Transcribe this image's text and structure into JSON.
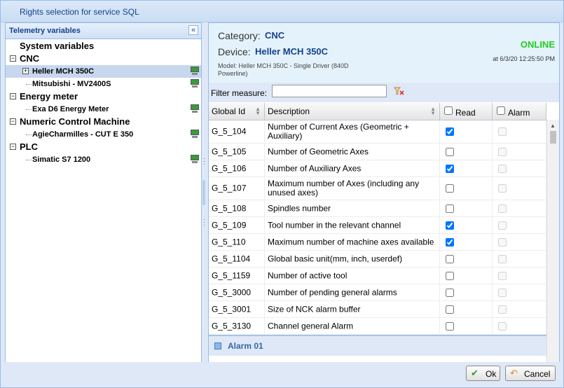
{
  "window": {
    "title": "Rights selection for service SQL"
  },
  "left_panel": {
    "title": "Telemetry variables",
    "tree": [
      {
        "type": "root",
        "label": "System variables"
      },
      {
        "type": "group",
        "label": "CNC",
        "expander": "⊟"
      },
      {
        "type": "leaf",
        "label": "Heller MCH 350C",
        "expander": "⊞",
        "selected": true
      },
      {
        "type": "leaf",
        "label": "Mitsubishi - MV2400S"
      },
      {
        "type": "group",
        "label": "Energy meter",
        "expander": "⊟"
      },
      {
        "type": "leaf",
        "label": "Exa D6 Energy Meter"
      },
      {
        "type": "group",
        "label": "Numeric Control Machine",
        "expander": "⊟"
      },
      {
        "type": "leaf",
        "label": "AgieCharmilles - CUT E 350"
      },
      {
        "type": "group",
        "label": "PLC",
        "expander": "⊟"
      },
      {
        "type": "leaf",
        "label": "Simatic S7 1200"
      }
    ]
  },
  "info": {
    "category_label": "Category:",
    "category_value": "CNC",
    "device_label": "Device:",
    "device_value": "Heller MCH 350C",
    "model": "Model: Heller MCH 350C - Single Driver (840D Powerline)",
    "status": "ONLINE",
    "status_color": "#22cc22",
    "timestamp": "at 6/3/20 12:25:50 PM"
  },
  "filter": {
    "label": "Filter measure:",
    "value": "",
    "placeholder": ""
  },
  "grid": {
    "columns": {
      "id": "Global Id",
      "description": "Description",
      "read": "Read",
      "alarm": "Alarm"
    },
    "rows": [
      {
        "id": "G_5_104",
        "description": "Number of Current Axes (Geometric + Auxiliary)",
        "read": true,
        "alarm": false
      },
      {
        "id": "G_5_105",
        "description": "Number of Geometric Axes",
        "read": false,
        "alarm": false
      },
      {
        "id": "G_5_106",
        "description": "Number of Auxiliary Axes",
        "read": true,
        "alarm": false
      },
      {
        "id": "G_5_107",
        "description": "Maximum number of Axes (including any unused axes)",
        "read": false,
        "alarm": false
      },
      {
        "id": "G_5_108",
        "description": "Spindles number",
        "read": false,
        "alarm": false
      },
      {
        "id": "G_5_109",
        "description": "Tool number in the relevant channel",
        "read": true,
        "alarm": false
      },
      {
        "id": "G_5_110",
        "description": "Maximum number of machine axes available",
        "read": true,
        "alarm": false
      },
      {
        "id": "G_5_1104",
        "description": "Global basic unit(mm, inch, userdef)",
        "read": false,
        "alarm": false
      },
      {
        "id": "G_5_1159",
        "description": "Number of active tool",
        "read": false,
        "alarm": false
      },
      {
        "id": "G_5_3000",
        "description": "Number of pending general alarms",
        "read": false,
        "alarm": false
      },
      {
        "id": "G_5_3001",
        "description": "Size of NCK alarm buffer",
        "read": false,
        "alarm": false
      },
      {
        "id": "G_5_3130",
        "description": "Channel general Alarm",
        "read": false,
        "alarm": false
      }
    ],
    "group_title": "Alarm 01"
  },
  "footer": {
    "ok_label": "Ok",
    "cancel_label": "Cancel"
  }
}
